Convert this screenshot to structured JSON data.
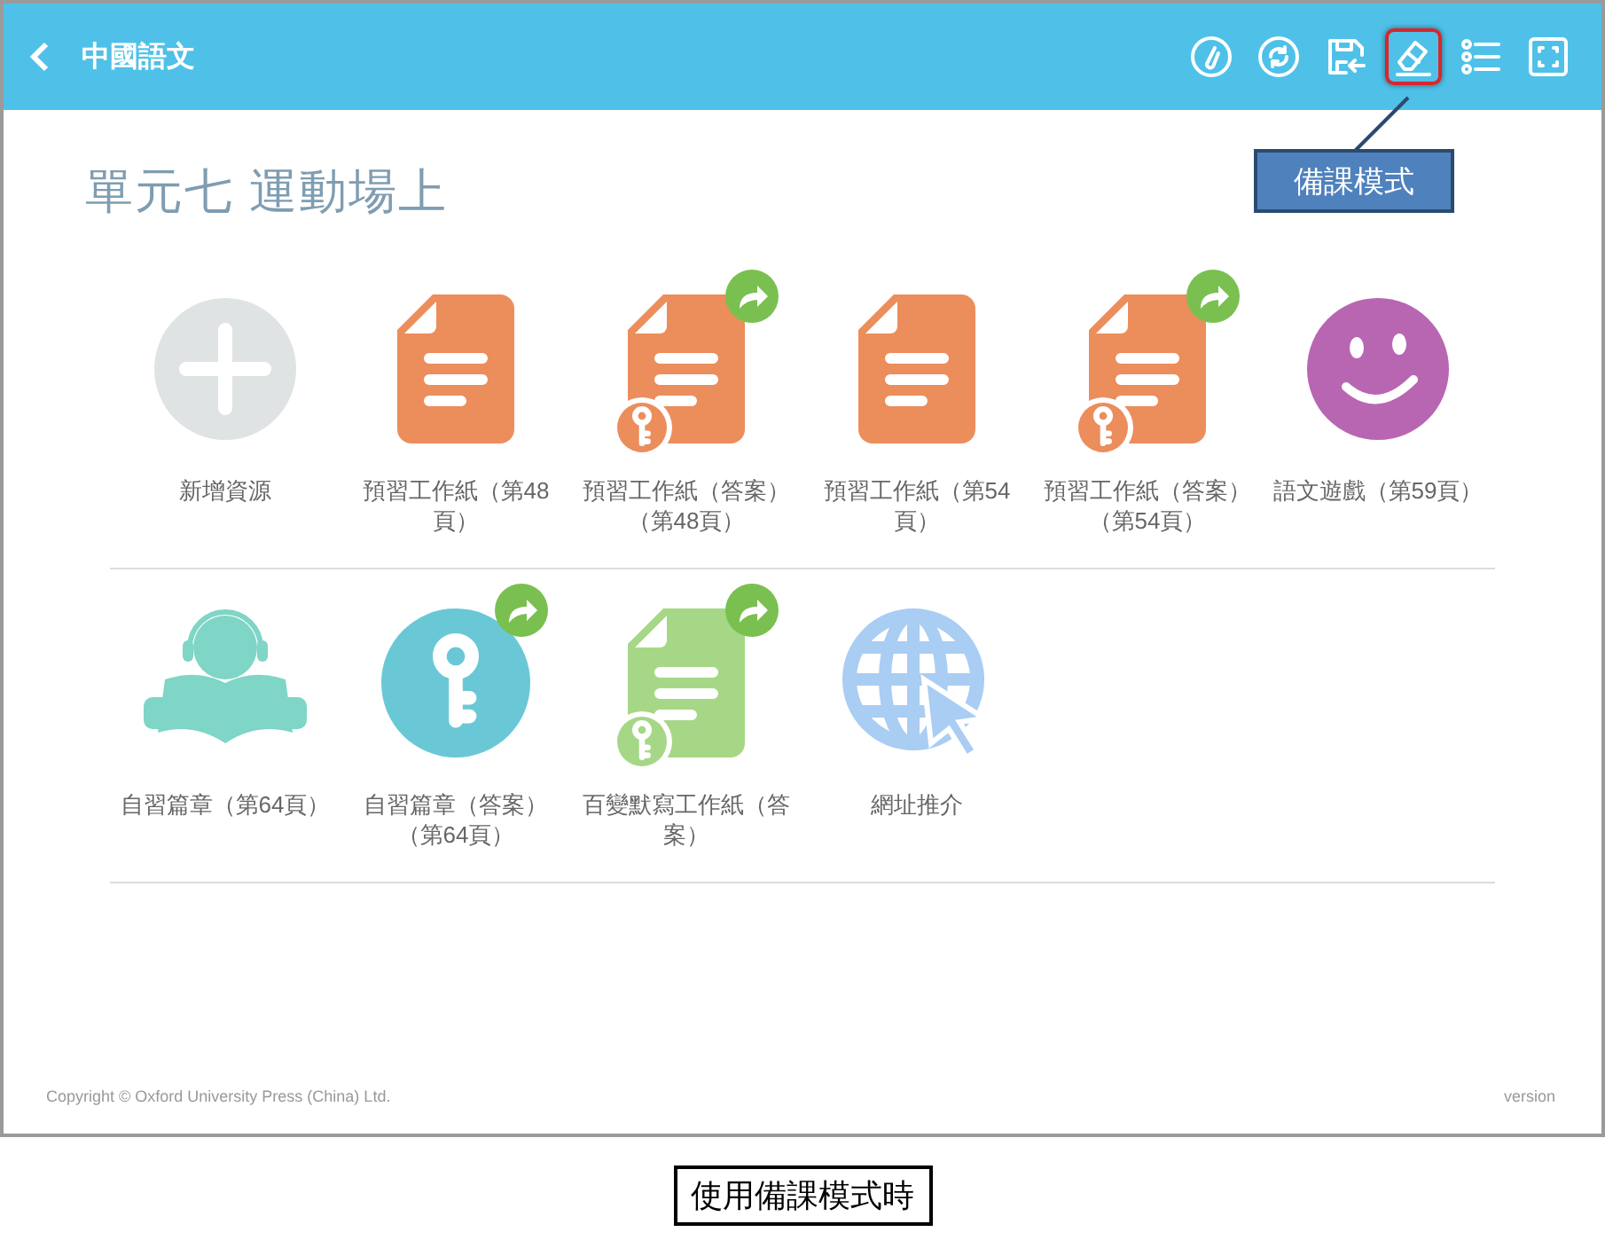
{
  "header": {
    "title": "中國語文",
    "tools": [
      {
        "kind": "attach",
        "highlighted": false
      },
      {
        "kind": "sync",
        "highlighted": false
      },
      {
        "kind": "save",
        "highlighted": false
      },
      {
        "kind": "eraser",
        "highlighted": true
      },
      {
        "kind": "list",
        "highlighted": false
      },
      {
        "kind": "fullscreen",
        "highlighted": false
      }
    ]
  },
  "callout": {
    "text": "備課模式"
  },
  "unit_title": "單元七 運動場上",
  "rows": [
    {
      "items": [
        {
          "kind": "add",
          "label": "新增資源",
          "color": "#dfe3e4",
          "answer": false,
          "shared": false
        },
        {
          "kind": "worksheet",
          "label": "預習工作紙（第48頁）",
          "color": "#ec8d5c",
          "answer": false,
          "shared": false
        },
        {
          "kind": "worksheet",
          "label": "預習工作紙（答案）（第48頁）",
          "color": "#ec8d5c",
          "answer": true,
          "shared": true
        },
        {
          "kind": "worksheet",
          "label": "預習工作紙（第54頁）",
          "color": "#ec8d5c",
          "answer": false,
          "shared": false
        },
        {
          "kind": "worksheet",
          "label": "預習工作紙（答案）（第54頁）",
          "color": "#ec8d5c",
          "answer": true,
          "shared": true
        },
        {
          "kind": "game",
          "label": "語文遊戲（第59頁）",
          "color": "#b866b2",
          "answer": false,
          "shared": false
        }
      ]
    },
    {
      "items": [
        {
          "kind": "reading",
          "label": "自習篇章（第64頁）",
          "color": "#7fd5c6",
          "answer": false,
          "shared": false
        },
        {
          "kind": "key",
          "label": "自習篇章（答案）（第64頁）",
          "color": "#6ac8d6",
          "answer": false,
          "shared": true
        },
        {
          "kind": "worksheet",
          "label": "百變默寫工作紙（答案）",
          "color": "#a6d786",
          "answer": true,
          "shared": true
        },
        {
          "kind": "link",
          "label": "網址推介",
          "color": "#a9cdf3",
          "answer": false,
          "shared": false
        }
      ]
    }
  ],
  "footer": {
    "copyright": "Copyright © Oxford University Press (China) Ltd.",
    "version": "version"
  },
  "caption": "使用備課模式時"
}
